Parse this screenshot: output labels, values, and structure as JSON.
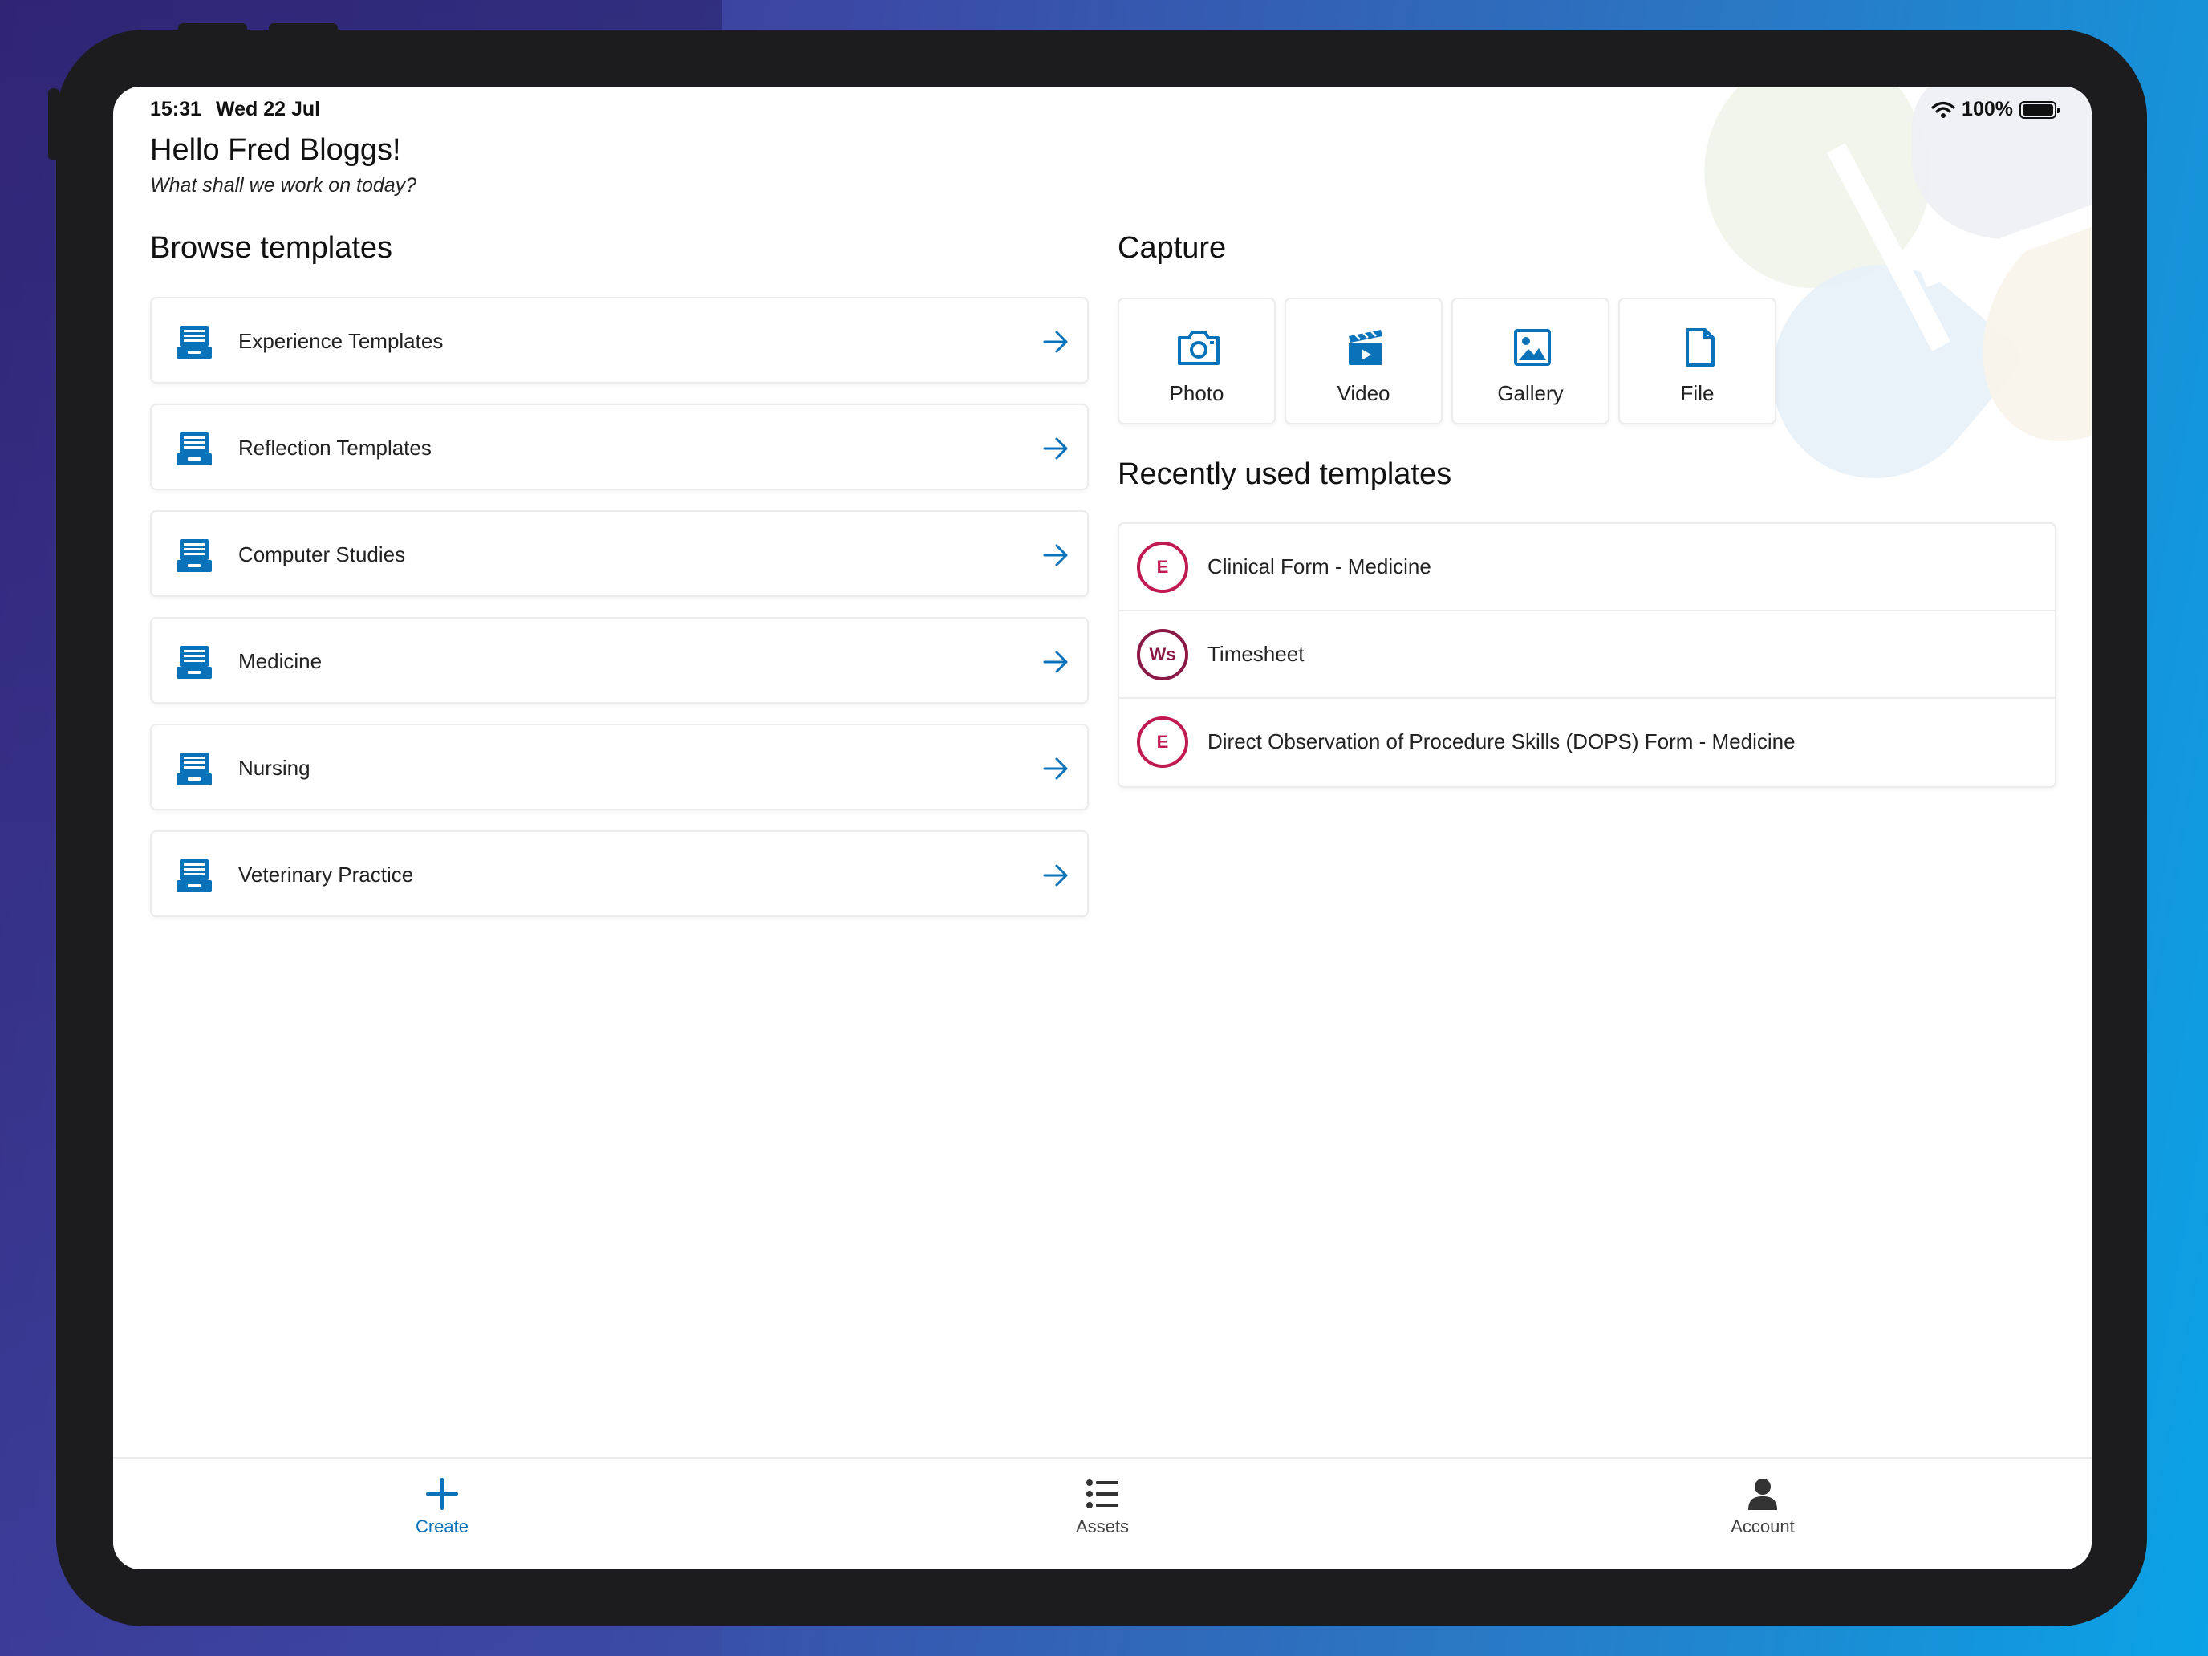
{
  "status_bar": {
    "time": "15:31",
    "date": "Wed 22 Jul",
    "battery": "100%"
  },
  "greeting": {
    "title": "Hello Fred Bloggs!",
    "subtitle": "What shall we work on today?"
  },
  "browse": {
    "title": "Browse templates",
    "items": [
      {
        "label": "Experience Templates"
      },
      {
        "label": "Reflection Templates"
      },
      {
        "label": "Computer Studies"
      },
      {
        "label": "Medicine"
      },
      {
        "label": "Nursing"
      },
      {
        "label": "Veterinary Practice"
      }
    ]
  },
  "capture": {
    "title": "Capture",
    "items": [
      {
        "label": "Photo",
        "icon": "camera-icon"
      },
      {
        "label": "Video",
        "icon": "video-clapper-icon"
      },
      {
        "label": "Gallery",
        "icon": "image-icon"
      },
      {
        "label": "File",
        "icon": "file-icon"
      }
    ]
  },
  "recent": {
    "title": "Recently used templates",
    "items": [
      {
        "badge": "E",
        "label": "Clinical Form - Medicine"
      },
      {
        "badge": "Ws",
        "label": "Timesheet"
      },
      {
        "badge": "E",
        "label": "Direct Observation of Procedure Skills (DOPS) Form - Medicine"
      }
    ]
  },
  "tabs": [
    {
      "label": "Create",
      "icon": "plus-icon",
      "active": true
    },
    {
      "label": "Assets",
      "icon": "list-icon",
      "active": false
    },
    {
      "label": "Account",
      "icon": "person-icon",
      "active": false
    }
  ],
  "colors": {
    "accent": "#0a72b8",
    "badge": "#c01a50",
    "badge_ws": "#8a1a45"
  }
}
